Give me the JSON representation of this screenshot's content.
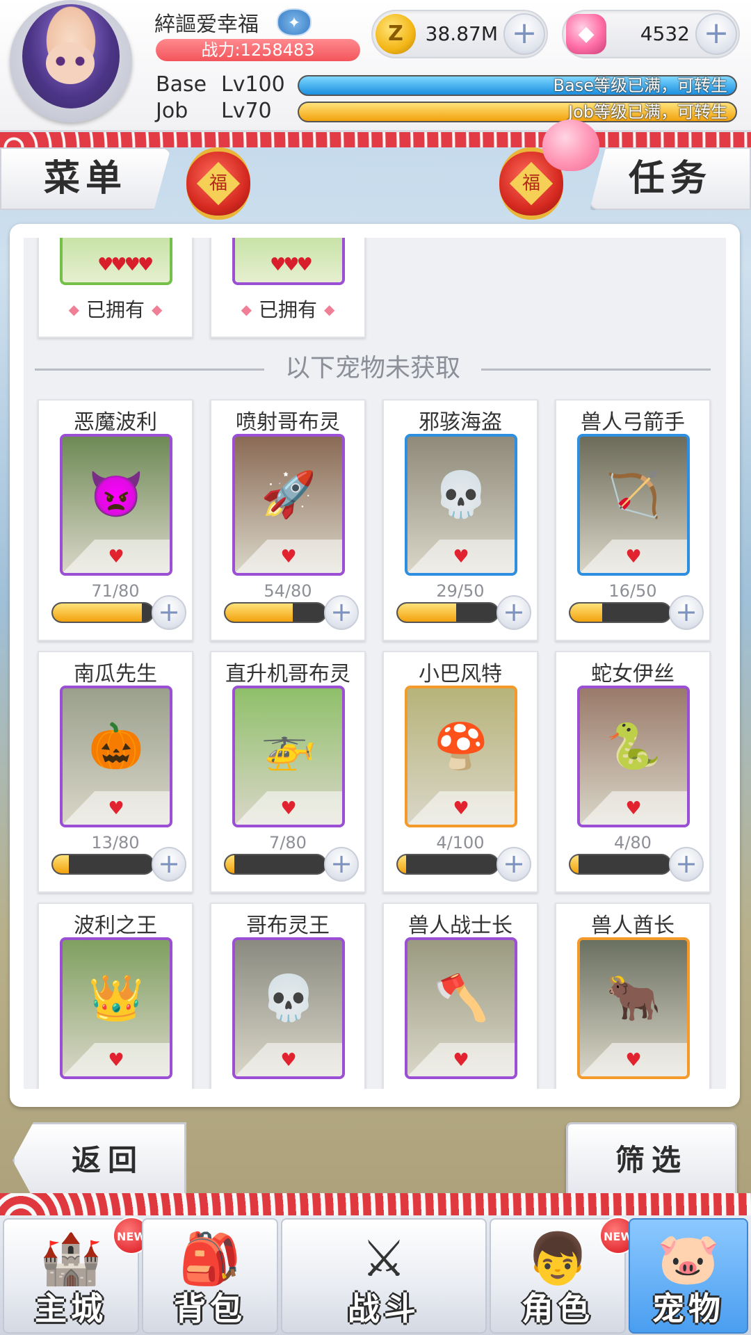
{
  "player": {
    "name": "綷謳爱幸福",
    "vip_icon": "shield-wings-icon",
    "power_label": "战力:1258483"
  },
  "currency": {
    "zeny": {
      "icon": "zeny-coin-icon",
      "symbol": "Z",
      "value": "38.87M"
    },
    "gem": {
      "icon": "pink-gem-icon",
      "value": "4532"
    },
    "plus_symbol": "+"
  },
  "levels": {
    "base": {
      "label": "Base",
      "level": "Lv100",
      "bar_text": "Base等级已满，可转生",
      "fill": 1.0,
      "color": "#1a8fe0"
    },
    "job": {
      "label": "Job",
      "level": "Lv70",
      "bar_text": "Job等级已满，可转生",
      "fill": 1.0,
      "color": "#f2a20d"
    }
  },
  "tabs": {
    "menu": "菜单",
    "task": "任务",
    "lantern_char": "福"
  },
  "owned": {
    "label": "已拥有",
    "cards": [
      {
        "frame": "green",
        "hearts": "♥♥♥♥"
      },
      {
        "frame": "purple",
        "hearts": "♥♥♥"
      }
    ]
  },
  "section_title": "以下宠物未获取",
  "pets": [
    {
      "name": "恶魔波利",
      "frame": "purple",
      "count": "71/80",
      "progress": 0.8875,
      "bg": "#6e8a55",
      "glyph": "👿"
    },
    {
      "name": "喷射哥布灵",
      "frame": "purple",
      "count": "54/80",
      "progress": 0.675,
      "bg": "#8a6a55",
      "glyph": "🚀"
    },
    {
      "name": "邪骇海盗",
      "frame": "blue",
      "count": "29/50",
      "progress": 0.58,
      "bg": "#8f8a7a",
      "glyph": "💀"
    },
    {
      "name": "兽人弓箭手",
      "frame": "blue",
      "count": "16/50",
      "progress": 0.32,
      "bg": "#6c6a58",
      "glyph": "🏹"
    },
    {
      "name": "南瓜先生",
      "frame": "purple",
      "count": "13/80",
      "progress": 0.1625,
      "bg": "#9aa08c",
      "glyph": "🎃"
    },
    {
      "name": "直升机哥布灵",
      "frame": "purple",
      "count": "7/80",
      "progress": 0.0875,
      "bg": "#8fc06a",
      "glyph": "🚁"
    },
    {
      "name": "小巴风特",
      "frame": "orange",
      "count": "4/100",
      "progress": 0.04,
      "bg": "#b7b37a",
      "glyph": "🍄"
    },
    {
      "name": "蛇女伊丝",
      "frame": "purple",
      "count": "4/80",
      "progress": 0.05,
      "bg": "#9a7a6a",
      "glyph": "🐍"
    },
    {
      "name": "波利之王",
      "frame": "purple",
      "count": "",
      "progress": 0,
      "bg": "#7fa060",
      "glyph": "👑"
    },
    {
      "name": "哥布灵王",
      "frame": "purple",
      "count": "",
      "progress": 0,
      "bg": "#8a8a80",
      "glyph": "💀"
    },
    {
      "name": "兽人战士长",
      "frame": "purple",
      "count": "",
      "progress": 0,
      "bg": "#9a9a80",
      "glyph": "🪓"
    },
    {
      "name": "兽人酋长",
      "frame": "orange",
      "count": "",
      "progress": 0,
      "bg": "#6a7060",
      "glyph": "🐂"
    }
  ],
  "heart_symbol": "♥",
  "buttons": {
    "back": "返回",
    "filter": "筛选"
  },
  "nav": [
    {
      "label": "主城",
      "icon": "castle-icon",
      "glyph": "🏰",
      "badge": "NEW",
      "active": false
    },
    {
      "label": "背包",
      "icon": "backpack-icon",
      "glyph": "🎒",
      "badge": "",
      "active": false
    },
    {
      "label": "战斗",
      "icon": "crossed-swords-icon",
      "glyph": "⚔",
      "badge": "",
      "active": false
    },
    {
      "label": "角色",
      "icon": "character-icon",
      "glyph": "👦",
      "badge": "NEW",
      "active": false
    },
    {
      "label": "宠物",
      "icon": "poring-pet-icon",
      "glyph": "🐷",
      "badge": "",
      "active": true
    }
  ]
}
